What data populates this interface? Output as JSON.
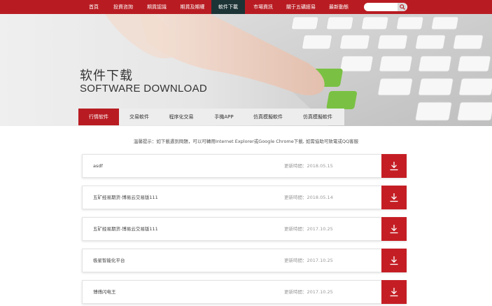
{
  "nav": {
    "items": [
      {
        "label": "首頁"
      },
      {
        "label": "投資咨詢"
      },
      {
        "label": "期貨認識"
      },
      {
        "label": "期貨及期權"
      },
      {
        "label": "軟件下載"
      },
      {
        "label": "市場資訊"
      },
      {
        "label": "關于五礦經易"
      },
      {
        "label": "最新動態"
      }
    ],
    "active_index": 4,
    "search_placeholder": ""
  },
  "banner": {
    "title_cn": "软件下载",
    "title_en": "SOFTWARE DOWNLOAD"
  },
  "tabs": [
    {
      "label": "行情软件"
    },
    {
      "label": "交易軟件"
    },
    {
      "label": "程序化交易"
    },
    {
      "label": "手機APP"
    },
    {
      "label": "仿真模擬軟件"
    },
    {
      "label": "仿真模擬軟件"
    }
  ],
  "tip": "溫馨提示：如下載遇到問題，可以可轉用Internet Explorer或Google Chrome下載, 如需協助可致電或QQ客服",
  "downloads": [
    {
      "name": "asdf",
      "date": "更新時間：2018.05.15"
    },
    {
      "name": "五矿经易期货-博易云交易版111",
      "date": "更新時間：2018.05.14"
    },
    {
      "name": "五矿经易期货-博易云交易版111",
      "date": "更新時間：2017.10.25"
    },
    {
      "name": "极星智能化平台",
      "date": "更新時間：2017.10.25"
    },
    {
      "name": "博傅闪电王",
      "date": "更新時間：2017.10.25"
    }
  ],
  "colors": {
    "brand": "#b81c22",
    "active_nav": "#1c3436",
    "download_button": "#c41e24"
  },
  "icons": {
    "search": "search-icon",
    "download": "download-icon"
  }
}
